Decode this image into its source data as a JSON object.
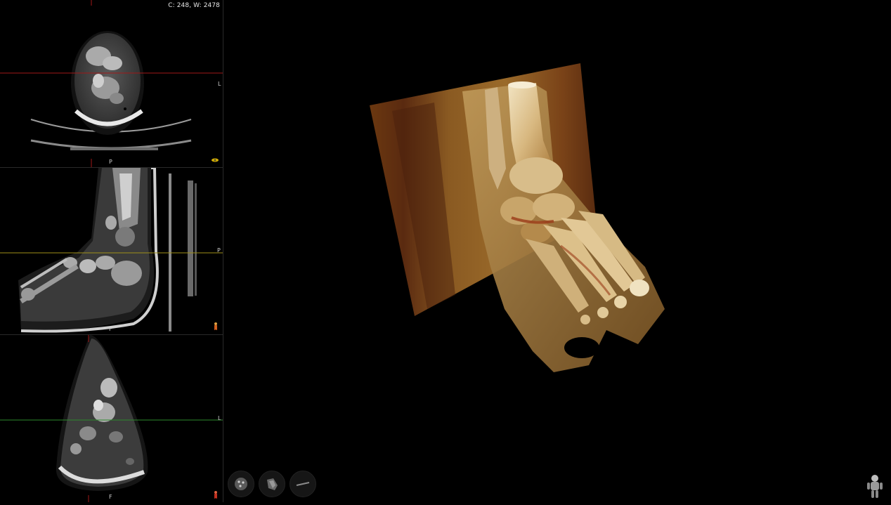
{
  "window_level": "C: 248, W: 2478",
  "viewports": {
    "axial": {
      "bottom_label": "P",
      "right_label": "L",
      "icon": "eye-orientation-icon"
    },
    "sagittal": {
      "bottom_label": "F",
      "right_label": "P",
      "icon": "body-orientation-icon"
    },
    "coronal": {
      "bottom_label": "F",
      "right_label": "L",
      "icon": "body-orientation-icon"
    }
  },
  "crosshair_colors": {
    "red": "#a01818",
    "yellow": "#a09018",
    "green": "#2c8a2c"
  },
  "toolbar": [
    {
      "name": "volume-render-tool",
      "icon": "sphere-dots-icon"
    },
    {
      "name": "bone-tool",
      "icon": "bone-icon"
    },
    {
      "name": "slice-tool",
      "icon": "line-icon"
    }
  ],
  "orientation_widget": {
    "icon": "human-figure-icon"
  }
}
